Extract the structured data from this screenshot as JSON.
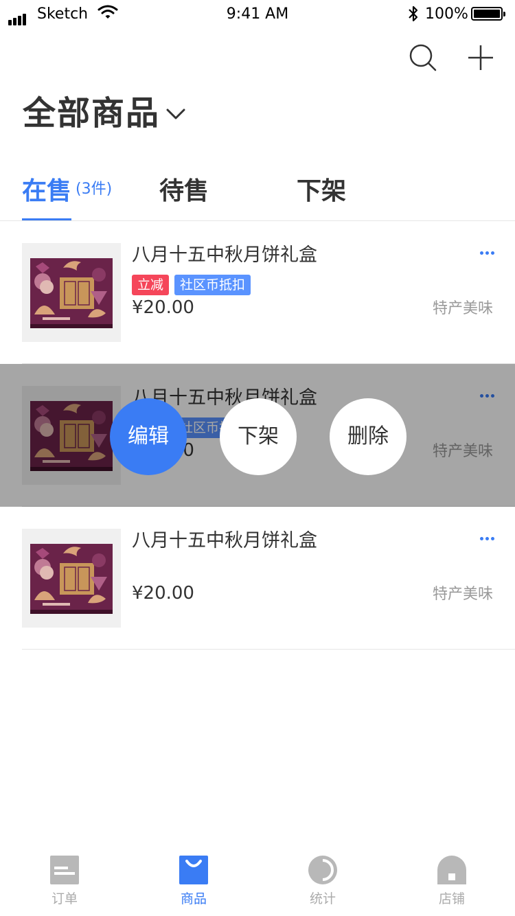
{
  "status_bar": {
    "carrier": "Sketch",
    "time": "9:41 AM",
    "battery": "100%"
  },
  "header": {
    "title": "全部商品",
    "search_icon": "search-icon",
    "add_icon": "plus-icon"
  },
  "tabs": [
    {
      "label": "在售",
      "count": "(3件)",
      "active": true
    },
    {
      "label": "待售"
    },
    {
      "label": "下架"
    }
  ],
  "products": [
    {
      "name": "八月十五中秋月饼礼盒",
      "tags": [
        "立减",
        "社区币抵扣"
      ],
      "price": "¥20.00",
      "category": "特产美味"
    },
    {
      "name": "八月十五中秋月饼礼盒",
      "tags": [
        "立减",
        "社区币抵扣"
      ],
      "price": "¥20.00",
      "category": "特产美味"
    },
    {
      "name": "八月十五中秋月饼礼盒",
      "tags": [],
      "price": "¥20.00",
      "category": "特产美味"
    }
  ],
  "row_actions": {
    "edit": "编辑",
    "off_shelf": "下架",
    "delete": "删除"
  },
  "bottom_nav": [
    {
      "label": "订单",
      "icon": "orders-icon"
    },
    {
      "label": "商品",
      "icon": "goods-icon",
      "active": true
    },
    {
      "label": "统计",
      "icon": "stats-icon"
    },
    {
      "label": "店铺",
      "icon": "store-icon"
    }
  ],
  "colors": {
    "accent": "#3a7cf4",
    "tag_red": "#f5465a",
    "tag_blue": "#5a93ff"
  }
}
